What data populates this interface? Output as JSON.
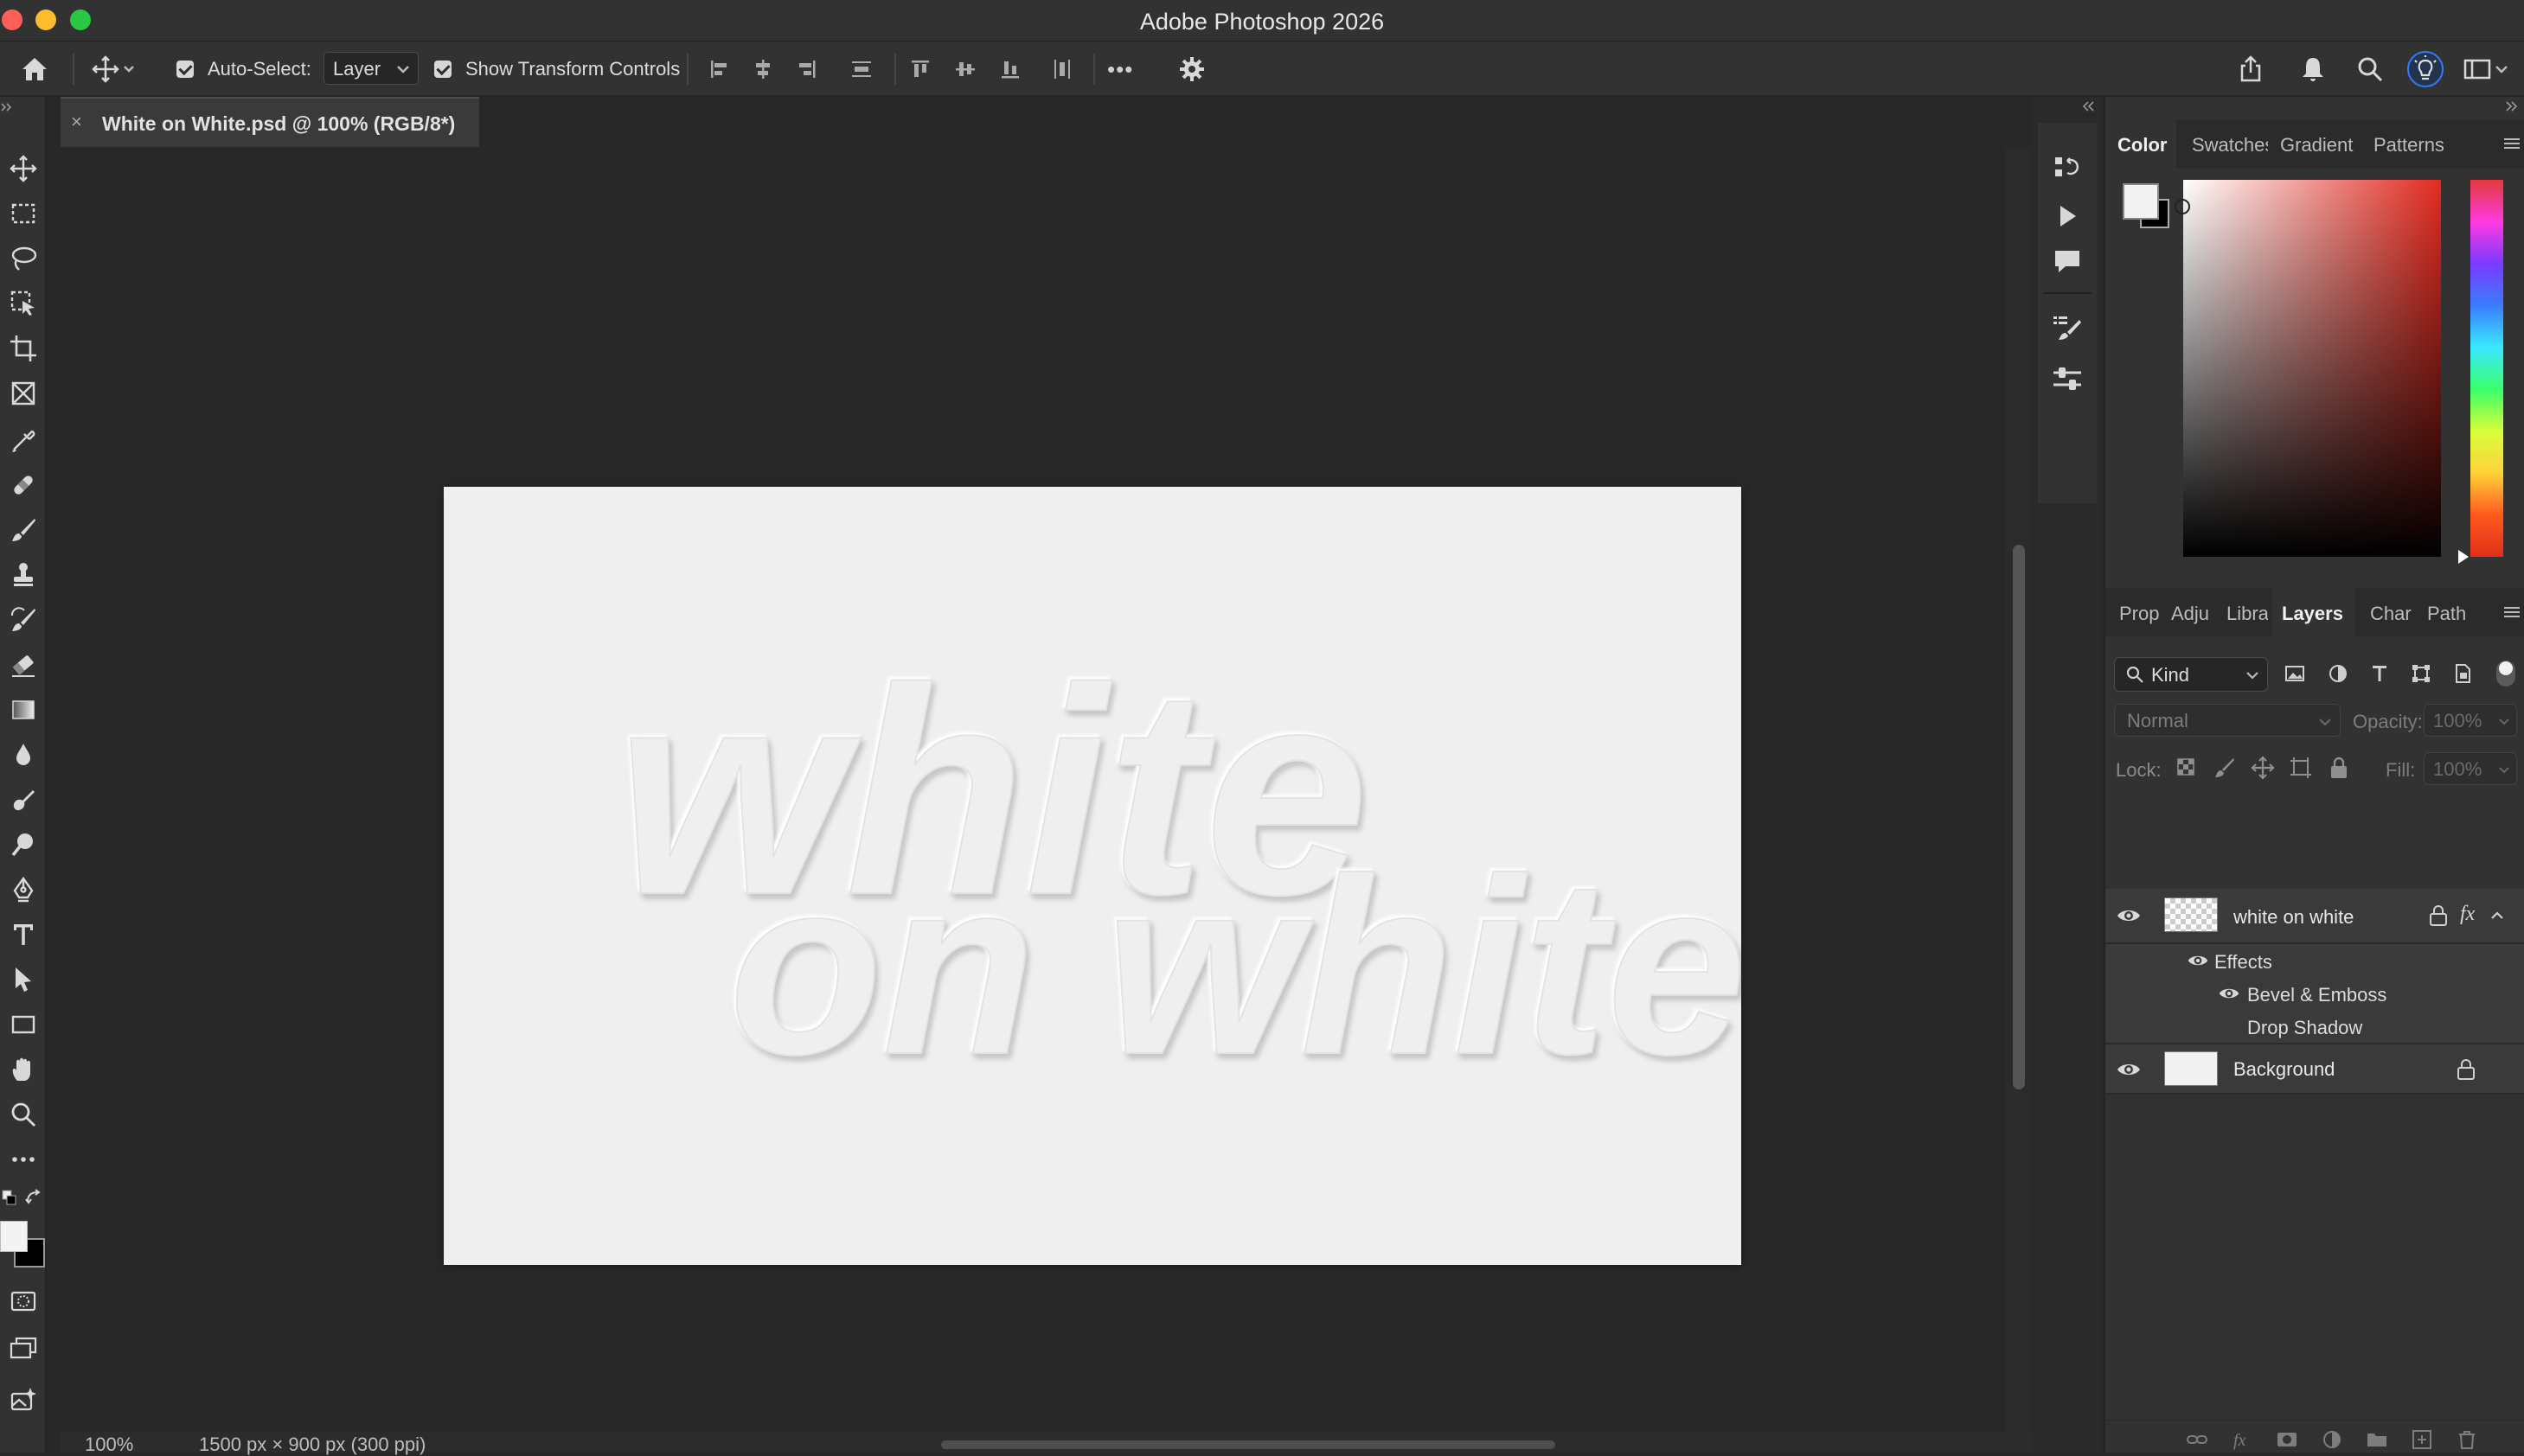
{
  "window": {
    "title": "Adobe Photoshop 2026"
  },
  "options_bar": {
    "auto_select_label": "Auto-Select:",
    "auto_select_target": "Layer",
    "show_transform_label": "Show Transform Controls",
    "more_label": "•••"
  },
  "document": {
    "tab_title": "White on White.psd @ 100% (RGB/8*)",
    "close_glyph": "×",
    "canvas_text_line1": "white",
    "canvas_text_line2": "on white",
    "zoom": "100%",
    "size_info": "1500 px × 900 px (300 ppi)"
  },
  "color_panel": {
    "tabs": [
      "Color",
      "Swatches",
      "Gradient",
      "Patterns"
    ],
    "active_tab": "Color",
    "foreground": "#f3f3f3",
    "background": "#000000"
  },
  "layers_panel": {
    "tabs": [
      "Prop",
      "Adju",
      "Libra",
      "Layers",
      "Char",
      "Path"
    ],
    "active_tab": "Layers",
    "filter_kind": "Kind",
    "blend_mode": "Normal",
    "opacity_label": "Opacity:",
    "opacity_value": "100%",
    "lock_label": "Lock:",
    "fill_label": "Fill:",
    "fill_value": "100%",
    "layers": [
      {
        "name": "white on white",
        "fx": "fx",
        "effects_label": "Effects",
        "effects": [
          "Bevel & Emboss",
          "Drop Shadow"
        ]
      },
      {
        "name": "Background"
      }
    ]
  },
  "colors": {
    "app_bg": "#282828",
    "panel_bg": "#323232",
    "canvas": "#efefef",
    "accent_blue": "#2f7cf6"
  }
}
